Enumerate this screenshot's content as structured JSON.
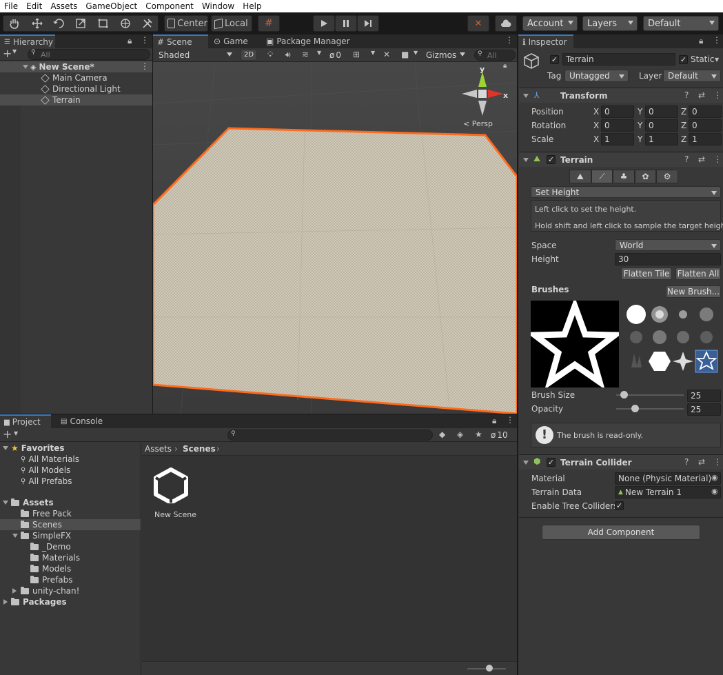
{
  "menu": [
    "File",
    "Edit",
    "Assets",
    "GameObject",
    "Component",
    "Window",
    "Help"
  ],
  "toolbar": {
    "center": "Center",
    "local": "Local",
    "account": "Account",
    "layers": "Layers",
    "layout": "Default"
  },
  "hierarchy": {
    "tab": "Hierarchy",
    "search_placeholder": "All",
    "scene": "New Scene*",
    "items": [
      "Main Camera",
      "Directional Light",
      "Terrain"
    ]
  },
  "scene_tabs": [
    "Scene",
    "Game",
    "Package Manager"
  ],
  "scene_toolbar": {
    "shading": "Shaded",
    "mode_2d": "2D",
    "hidden_count": "0",
    "gizmos": "Gizmos",
    "search_placeholder": "All"
  },
  "gizmo": {
    "y": "y",
    "x": "x",
    "persp": "< Persp"
  },
  "inspector": {
    "tab": "Inspector",
    "object_name": "Terrain",
    "static_label": "Static",
    "tag_label": "Tag",
    "tag_value": "Untagged",
    "layer_label": "Layer",
    "layer_value": "Default",
    "transform": {
      "title": "Transform",
      "rows": [
        {
          "label": "Position",
          "x": "0",
          "y": "0",
          "z": "0"
        },
        {
          "label": "Rotation",
          "x": "0",
          "y": "0",
          "z": "0"
        },
        {
          "label": "Scale",
          "x": "1",
          "y": "1",
          "z": "1"
        }
      ],
      "axis": [
        "X",
        "Y",
        "Z"
      ]
    },
    "terrain": {
      "title": "Terrain",
      "tool": "Set Height",
      "help1": "Left click to set the height.",
      "help2": "Hold shift and left click to sample the target height.",
      "space_label": "Space",
      "space_value": "World",
      "height_label": "Height",
      "height_value": "30",
      "flatten_tile": "Flatten Tile",
      "flatten_all": "Flatten All",
      "brushes_label": "Brushes",
      "new_brush": "New Brush...",
      "brush_size_label": "Brush Size",
      "brush_size_value": "25",
      "brush_size_fraction": 0.07,
      "opacity_label": "Opacity",
      "opacity_value": "25",
      "opacity_fraction": 0.25,
      "readonly_msg": "The brush is read-only."
    },
    "collider": {
      "title": "Terrain Collider",
      "material_label": "Material",
      "material_value": "None (Physic Material)",
      "data_label": "Terrain Data",
      "data_value": "New Terrain 1",
      "trees_label": "Enable Tree Colliders"
    },
    "add_component": "Add Component"
  },
  "project": {
    "tabs": [
      "Project",
      "Console"
    ],
    "hidden_count": "10",
    "favorites_label": "Favorites",
    "favorites": [
      "All Materials",
      "All Models",
      "All Prefabs"
    ],
    "assets_label": "Assets",
    "assets": [
      "Free Pack",
      "Scenes",
      "SimpleFX"
    ],
    "simplefx": [
      "_Demo",
      "Materials",
      "Models",
      "Prefabs"
    ],
    "unitychan": "unity-chan!",
    "packages": "Packages",
    "breadcrumb": [
      "Assets",
      "Scenes"
    ],
    "asset_name": "New Scene"
  },
  "colors": {
    "selection_outline": "#ff6a1c",
    "terrain": "#ccc4b2",
    "accent": "#3a79bb"
  }
}
